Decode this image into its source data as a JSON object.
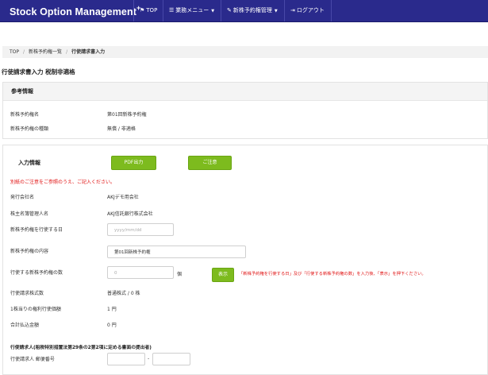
{
  "navbar": {
    "brand": "Stock Option Management",
    "brand_sup": "+",
    "items": [
      {
        "label": "TOP",
        "icon": "flag-icon",
        "glyph": "⚑",
        "has_caret": false
      },
      {
        "label": "業務メニュー",
        "icon": "menu-icon",
        "glyph": "☰",
        "has_caret": true
      },
      {
        "label": "新株予約権管理",
        "icon": "tag-icon",
        "glyph": "✎",
        "has_caret": true
      },
      {
        "label": "ログアウト",
        "icon": "logout-icon",
        "glyph": "⇥",
        "has_caret": false
      }
    ]
  },
  "breadcrumb": [
    "TOP",
    "新株予約権一覧",
    "行使請求書入力"
  ],
  "page_title": "行使請求書入力 税制非適格",
  "reference": {
    "heading": "参考情報",
    "rows": [
      {
        "label": "新株予約権名",
        "value": "第01回新株予約権"
      },
      {
        "label": "新株予約権の種類",
        "value": "無償 / 非適格"
      }
    ]
  },
  "input_section": {
    "heading": "入力情報",
    "pdf_button": "PDF出力",
    "notice_button": "ご注意",
    "notice_text": "別紙のご注意をご参照のうえ、ご記入ください。",
    "issuer_label": "発行会社名",
    "issuer_value": "AKJデモ用会社",
    "registrar_label": "株主名簿管理人名",
    "registrar_value": "AKJ信託銀行株式会社",
    "exercise_date_label": "新株予約権を行使する日",
    "exercise_date_placeholder": "yyyy/mm/dd",
    "content_label": "新株予約権の内容",
    "content_value": "第01回新株予約権",
    "count_label": "行使する新株予約権の数",
    "count_value": "0",
    "count_unit": "個",
    "show_button": "表示",
    "show_hint": "「新株予約権を行使する日」及び「行使する新株予約権の数」を入力後、「表示」を押下ください。",
    "shares_label": "行使請求株式数",
    "shares_value": "普通株式 / 0 株",
    "price_label": "1株当りの権利行使価額",
    "price_value": "1 円",
    "total_label": "合計払込金額",
    "total_value": "0 円",
    "requester_heading": "行使請求人(租税特別措置法第29条の2第2項に定める書面の提出者)",
    "postal_label": "行使請求人 郵便番号",
    "postal_sep": "-"
  }
}
